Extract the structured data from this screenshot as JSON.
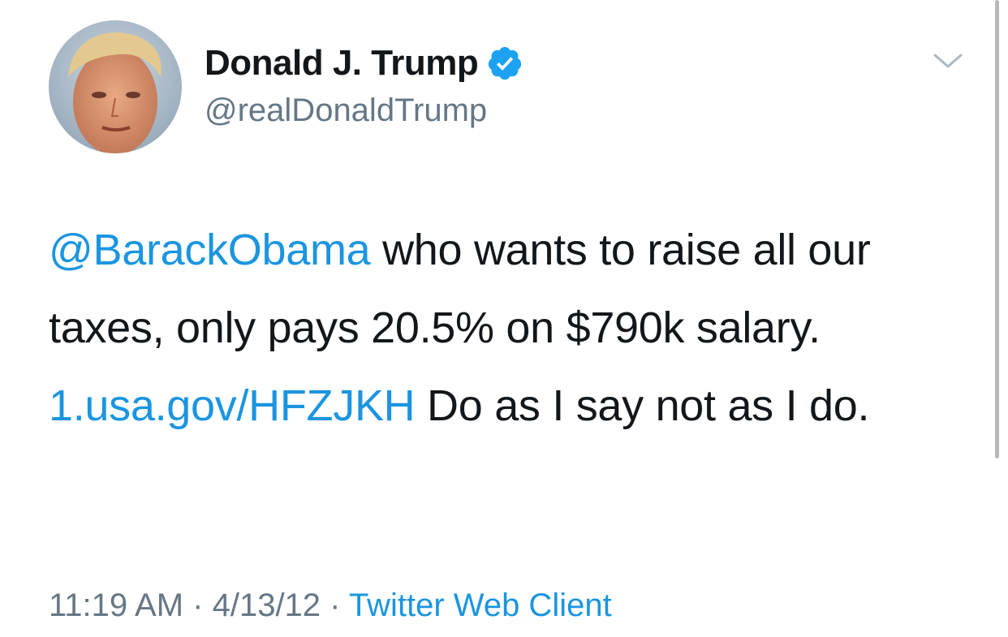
{
  "author": {
    "display_name": "Donald J. Trump",
    "handle": "@realDonaldTrump",
    "verified": true,
    "avatar_icon": "profile-photo",
    "verified_icon": "verified-badge-icon"
  },
  "menu": {
    "icon": "chevron-down-icon"
  },
  "tweet": {
    "mention": "@BarackObama",
    "text_part1": " who wants to raise all our taxes, only pays 20.5% on $790k salary. ",
    "link": "1.usa.gov/HFZJKH",
    "text_part2": " Do as I say not as I do."
  },
  "meta": {
    "time": "11:19 AM",
    "separator1": " · ",
    "date": "4/13/12",
    "separator2": " · ",
    "source": "Twitter Web Client"
  },
  "colors": {
    "link": "#1b95e0",
    "secondary_text": "#657786",
    "primary_text": "#14171a",
    "verified": "#1da1f2"
  }
}
